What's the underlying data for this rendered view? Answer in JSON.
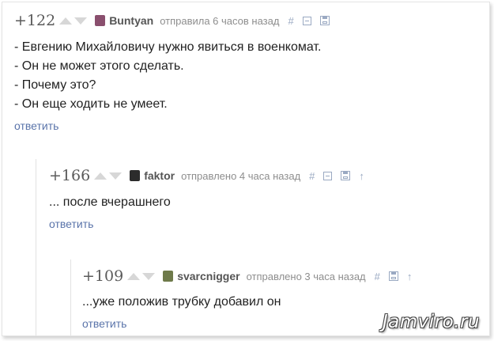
{
  "comments": [
    {
      "rating": "+122",
      "author": "Buntyan",
      "meta": "отправила 6 часов назад",
      "avatar_color": "#8a4f6e",
      "lines": [
        "- Евгению Михайловичу нужно явиться в военкомат.",
        "- Он не может этого сделать.",
        "- Почему это?",
        "- Он еще ходить не умеет."
      ],
      "reply": "ответить",
      "tools": {
        "hash": "#",
        "parent": "↑"
      }
    },
    {
      "rating": "+166",
      "author": "faktor",
      "meta": "отправлено 4 часа назад",
      "avatar_color": "#2c2c2c",
      "lines": [
        "... после вчерашнего"
      ],
      "reply": "ответить",
      "tools": {
        "hash": "#",
        "parent": "↑"
      }
    },
    {
      "rating": "+109",
      "author": "svarcnigger",
      "meta": "отправлено 3 часа назад",
      "avatar_color": "#6e7a4a",
      "lines": [
        "...уже положив трубку добавил он"
      ],
      "reply": "ответить",
      "tools": {
        "hash": "#",
        "parent": "↑"
      }
    }
  ],
  "watermark": "Jamviro.ru",
  "colors": {
    "link": "#5a74aa",
    "tool": "#9aa9c2",
    "rating": "#5b5b5b"
  }
}
